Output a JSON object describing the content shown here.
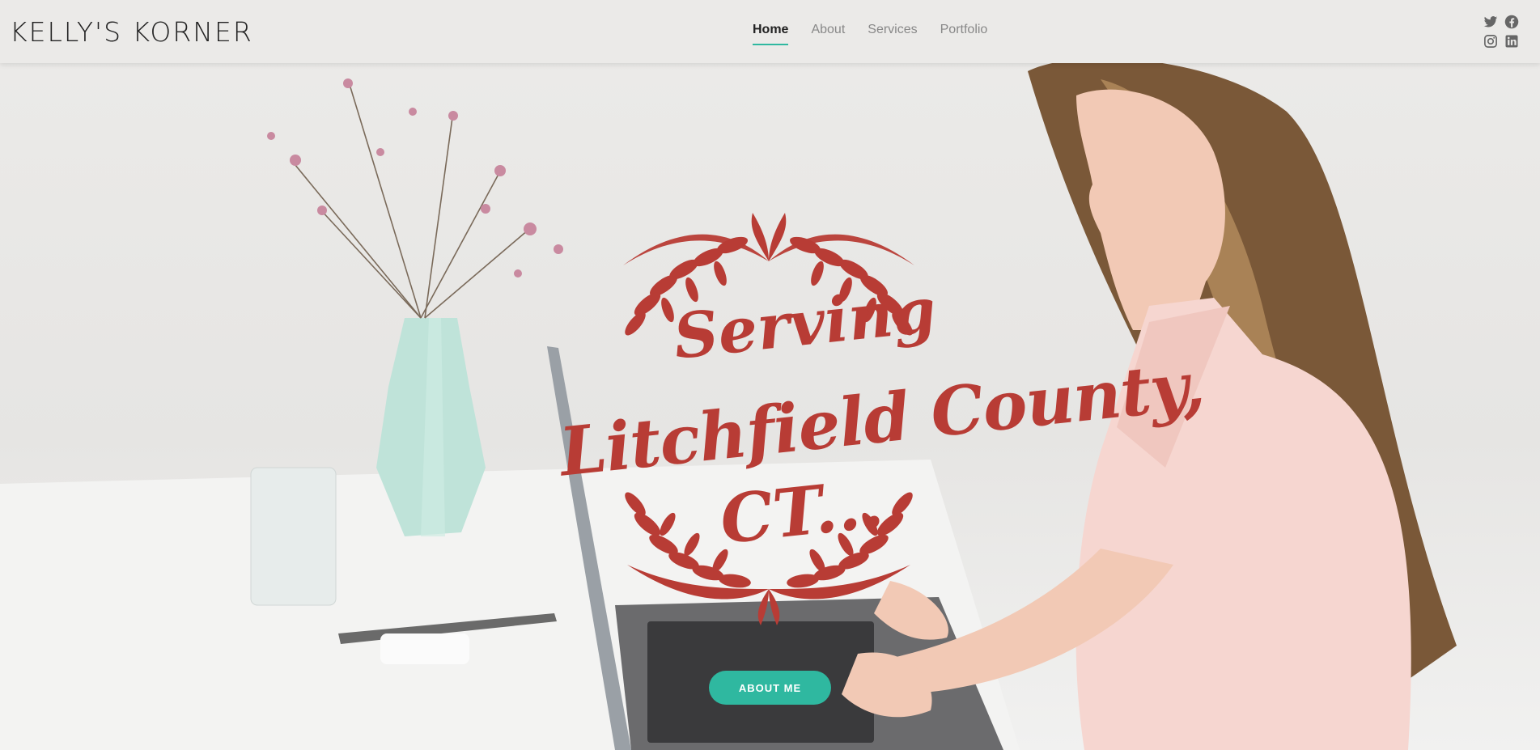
{
  "header": {
    "logo": "KELLY'S KORNER",
    "nav": [
      {
        "label": "Home",
        "active": true
      },
      {
        "label": "About",
        "active": false
      },
      {
        "label": "Services",
        "active": false
      },
      {
        "label": "Portfolio",
        "active": false
      }
    ],
    "social_icons": [
      "twitter-icon",
      "facebook-icon",
      "instagram-icon",
      "linkedin-icon"
    ]
  },
  "hero": {
    "headline_line1": "Serving",
    "headline_line2": "Litchfield County,",
    "headline_line3": "CT...",
    "cta_label": "ABOUT ME"
  },
  "colors": {
    "accent": "#2fb8a0",
    "script_red": "#b83c35",
    "background": "#e9e8e6"
  }
}
